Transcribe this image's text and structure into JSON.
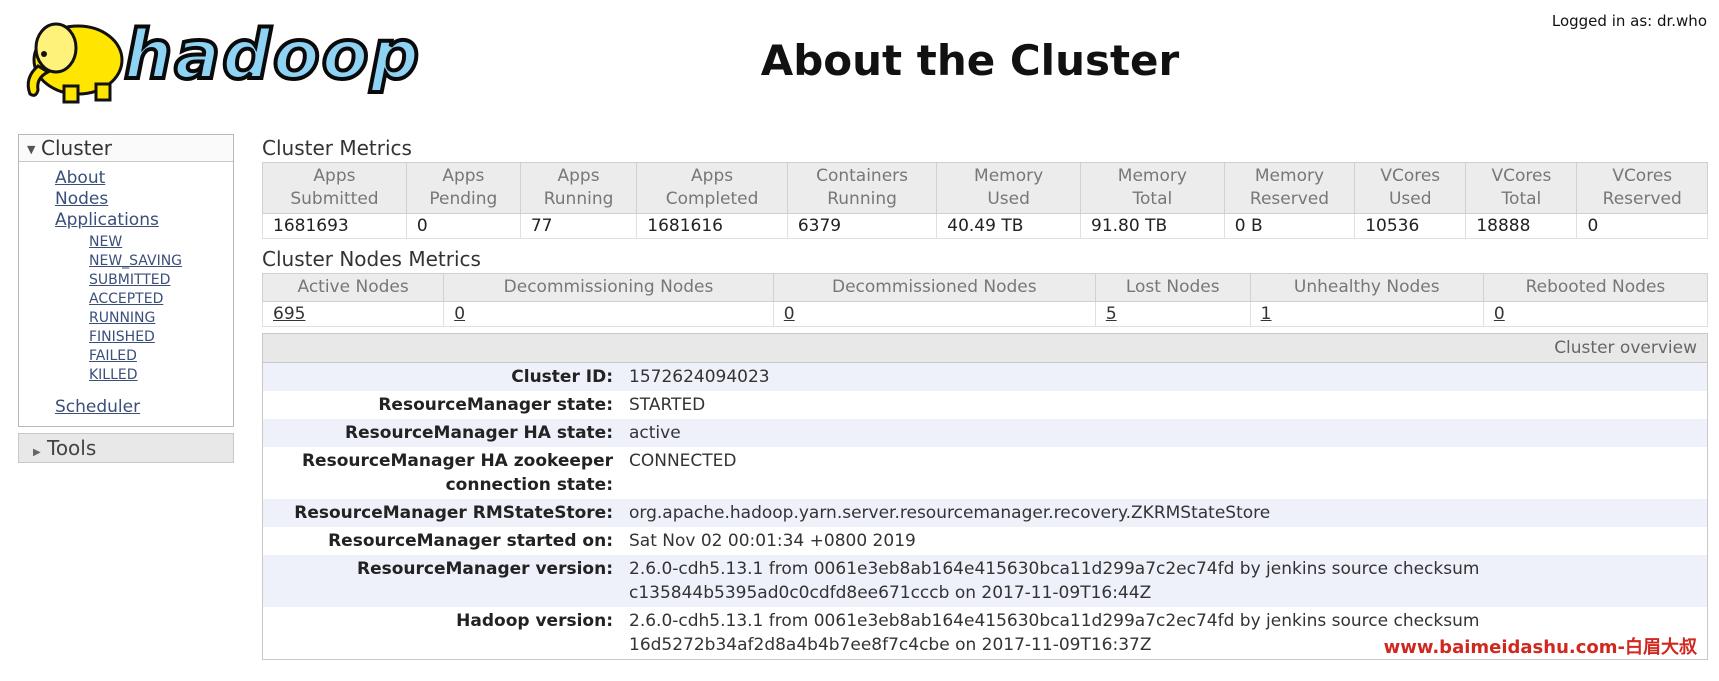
{
  "header": {
    "logged_in": "Logged in as: dr.who",
    "title": "About the Cluster",
    "logo_text": "hadoop"
  },
  "sidebar": {
    "cluster_label": "Cluster",
    "links": [
      "About",
      "Nodes",
      "Applications"
    ],
    "app_states": [
      "NEW",
      "NEW_SAVING",
      "SUBMITTED",
      "ACCEPTED",
      "RUNNING",
      "FINISHED",
      "FAILED",
      "KILLED"
    ],
    "scheduler": "Scheduler",
    "tools_label": "Tools"
  },
  "cluster_metrics": {
    "title": "Cluster Metrics",
    "headers": [
      [
        "Apps",
        "Submitted"
      ],
      [
        "Apps",
        "Pending"
      ],
      [
        "Apps",
        "Running"
      ],
      [
        "Apps",
        "Completed"
      ],
      [
        "Containers",
        "Running"
      ],
      [
        "Memory",
        "Used"
      ],
      [
        "Memory",
        "Total"
      ],
      [
        "Memory",
        "Reserved"
      ],
      [
        "VCores",
        "Used"
      ],
      [
        "VCores",
        "Total"
      ],
      [
        "VCores",
        "Reserved"
      ]
    ],
    "values": [
      "1681693",
      "0",
      "77",
      "1681616",
      "6379",
      "40.49 TB",
      "91.80 TB",
      "0 B",
      "10536",
      "18888",
      "0"
    ]
  },
  "node_metrics": {
    "title": "Cluster Nodes Metrics",
    "headers": [
      "Active Nodes",
      "Decommissioning Nodes",
      "Decommissioned Nodes",
      "Lost Nodes",
      "Unhealthy Nodes",
      "Rebooted Nodes"
    ],
    "values": [
      "695",
      "0",
      "0",
      "5",
      "1",
      "0"
    ]
  },
  "overview": {
    "title": "Cluster overview",
    "rows": [
      {
        "key": "Cluster ID:",
        "val": "1572624094023"
      },
      {
        "key": "ResourceManager state:",
        "val": "STARTED"
      },
      {
        "key": "ResourceManager HA state:",
        "val": "active"
      },
      {
        "key": "ResourceManager HA zookeeper connection state:",
        "val": "CONNECTED"
      },
      {
        "key": "ResourceManager RMStateStore:",
        "val": "org.apache.hadoop.yarn.server.resourcemanager.recovery.ZKRMStateStore"
      },
      {
        "key": "ResourceManager started on:",
        "val": "Sat Nov 02 00:01:34 +0800 2019"
      },
      {
        "key": "ResourceManager version:",
        "val": "2.6.0-cdh5.13.1 from 0061e3eb8ab164e415630bca11d299a7c2ec74fd by jenkins source checksum c135844b5395ad0c0cdfd8ee671cccb on 2017-11-09T16:44Z"
      },
      {
        "key": "Hadoop version:",
        "val": "2.6.0-cdh5.13.1 from 0061e3eb8ab164e415630bca11d299a7c2ec74fd by jenkins source checksum 16d5272b34af2d8a4b4b7ee8f7c4cbe on 2017-11-09T16:37Z"
      }
    ]
  },
  "watermark": "www.baimeidashu.com-白眉大叔"
}
